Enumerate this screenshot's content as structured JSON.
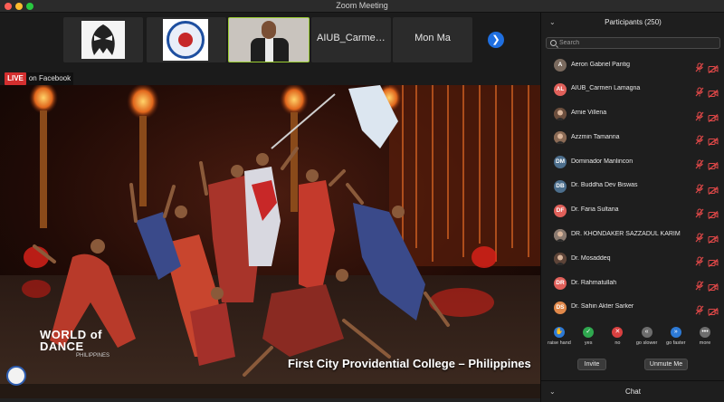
{
  "window": {
    "title": "Zoom Meeting"
  },
  "strip": {
    "tiles": [
      {
        "name": ""
      },
      {
        "name": ""
      },
      {
        "name": ""
      },
      {
        "name": "AIUB_Carmen..."
      },
      {
        "name": "Mon Ma"
      }
    ],
    "next_glyph": "❯"
  },
  "stream": {
    "live_label": "LIVE",
    "platform_label": "on Facebook",
    "caption": "First City Providential College – Philippines",
    "logo_line1": "WORLD of",
    "logo_line2": "DANCE",
    "logo_line3": "PHILIPPINES"
  },
  "participants": {
    "title": "Participants (250)",
    "collapse_glyph": "⌄",
    "search_placeholder": "Search",
    "list": [
      {
        "initials": "A",
        "name": "Aeron Gabriel Pantig",
        "avatar_color": "#7a6a5e",
        "photo": false
      },
      {
        "initials": "AL",
        "name": "AIUB_Carmen Lamagna",
        "avatar_color": "#e0605a",
        "photo": false
      },
      {
        "initials": "",
        "name": "Arnie Villena",
        "avatar_color": "#6b4e3d",
        "photo": true
      },
      {
        "initials": "",
        "name": "Azzmin Tamanna",
        "avatar_color": "#8a6a55",
        "photo": true
      },
      {
        "initials": "DM",
        "name": "Dominador Manlincon",
        "avatar_color": "#4c6e8c",
        "photo": false
      },
      {
        "initials": "DB",
        "name": "Dr. Buddha Dev Biswas",
        "avatar_color": "#4c6e8c",
        "photo": false
      },
      {
        "initials": "DF",
        "name": "Dr. Faria Sultana",
        "avatar_color": "#e0605a",
        "photo": false
      },
      {
        "initials": "",
        "name": "DR. KHONDAKER SAZZADUL KARIM",
        "avatar_color": "#8a7a70",
        "photo": true
      },
      {
        "initials": "",
        "name": "Dr. Mosaddeq",
        "avatar_color": "#5d4438",
        "photo": true
      },
      {
        "initials": "DR",
        "name": "Dr. Rahmatullah",
        "avatar_color": "#e0605a",
        "photo": false
      },
      {
        "initials": "DS",
        "name": "Dr. Sahin Akter Sarker",
        "avatar_color": "#e0884a",
        "photo": false
      }
    ]
  },
  "controls": [
    {
      "label": "raise hand",
      "glyph": "✋",
      "color": "#2d7ad6"
    },
    {
      "label": "yes",
      "glyph": "✓",
      "color": "#2fa84f"
    },
    {
      "label": "no",
      "glyph": "✕",
      "color": "#d94040"
    },
    {
      "label": "go slower",
      "glyph": "«",
      "color": "#6d6d6d"
    },
    {
      "label": "go faster",
      "glyph": "»",
      "color": "#2d7ad6"
    },
    {
      "label": "more",
      "glyph": "•••",
      "color": "#6d6d6d"
    }
  ],
  "actions": {
    "invite": "Invite",
    "unmute": "Unmute Me"
  },
  "chat": {
    "title": "Chat",
    "chevron": "⌄"
  },
  "colors": {
    "accent": "#1f6fe0",
    "muted_red": "#e04848",
    "speaker_border": "#9acd32"
  }
}
